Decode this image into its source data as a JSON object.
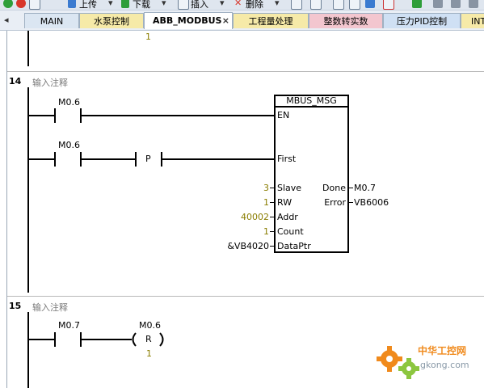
{
  "toolbar": {
    "upload": "上传",
    "download": "下载",
    "insert": "插入",
    "delete": "删除"
  },
  "tabs": [
    {
      "label": "MAIN",
      "active": false
    },
    {
      "label": "水泵控制",
      "active": false
    },
    {
      "label": "ABB_MODBUS",
      "active": true
    },
    {
      "label": "工程量处理",
      "active": false
    },
    {
      "label": "整数转实数",
      "active": false
    },
    {
      "label": "压力PID控制",
      "active": false
    },
    {
      "label": "INT",
      "active": false
    }
  ],
  "tab_close": "×",
  "tab_scroll_left": "◂",
  "prev_network": {
    "value": "1"
  },
  "networks": [
    {
      "number": "14",
      "comment": "输入注释",
      "contact1": "M0.6",
      "contact2": "M0.6",
      "p_contact": "P",
      "block": {
        "title": "MBUS_MSG",
        "en": "EN",
        "first": "First",
        "inputs": [
          {
            "pin": "Slave",
            "value": "3"
          },
          {
            "pin": "RW",
            "value": "1"
          },
          {
            "pin": "Addr",
            "value": "40002"
          },
          {
            "pin": "Count",
            "value": "1"
          },
          {
            "pin": "DataPtr",
            "value": "&VB4020"
          }
        ],
        "outputs": [
          {
            "pin": "Done",
            "value": "M0.7"
          },
          {
            "pin": "Error",
            "value": "VB6006"
          }
        ]
      }
    },
    {
      "number": "15",
      "comment": "输入注释",
      "contact": "M0.7",
      "coil_operand": "M0.6",
      "coil_type": "R",
      "coil_count": "1"
    }
  ],
  "watermark": {
    "name": "中华工控网",
    "url": "gkong.com"
  },
  "colors": {
    "tab_active": "#ffffff",
    "tab_yellow": "#f6eaa8",
    "tab_pink": "#f3c6cf",
    "tab_blue": "#cfe0f4",
    "watermark_orange": "#f08a1c",
    "watermark_green": "#8cc63f"
  }
}
